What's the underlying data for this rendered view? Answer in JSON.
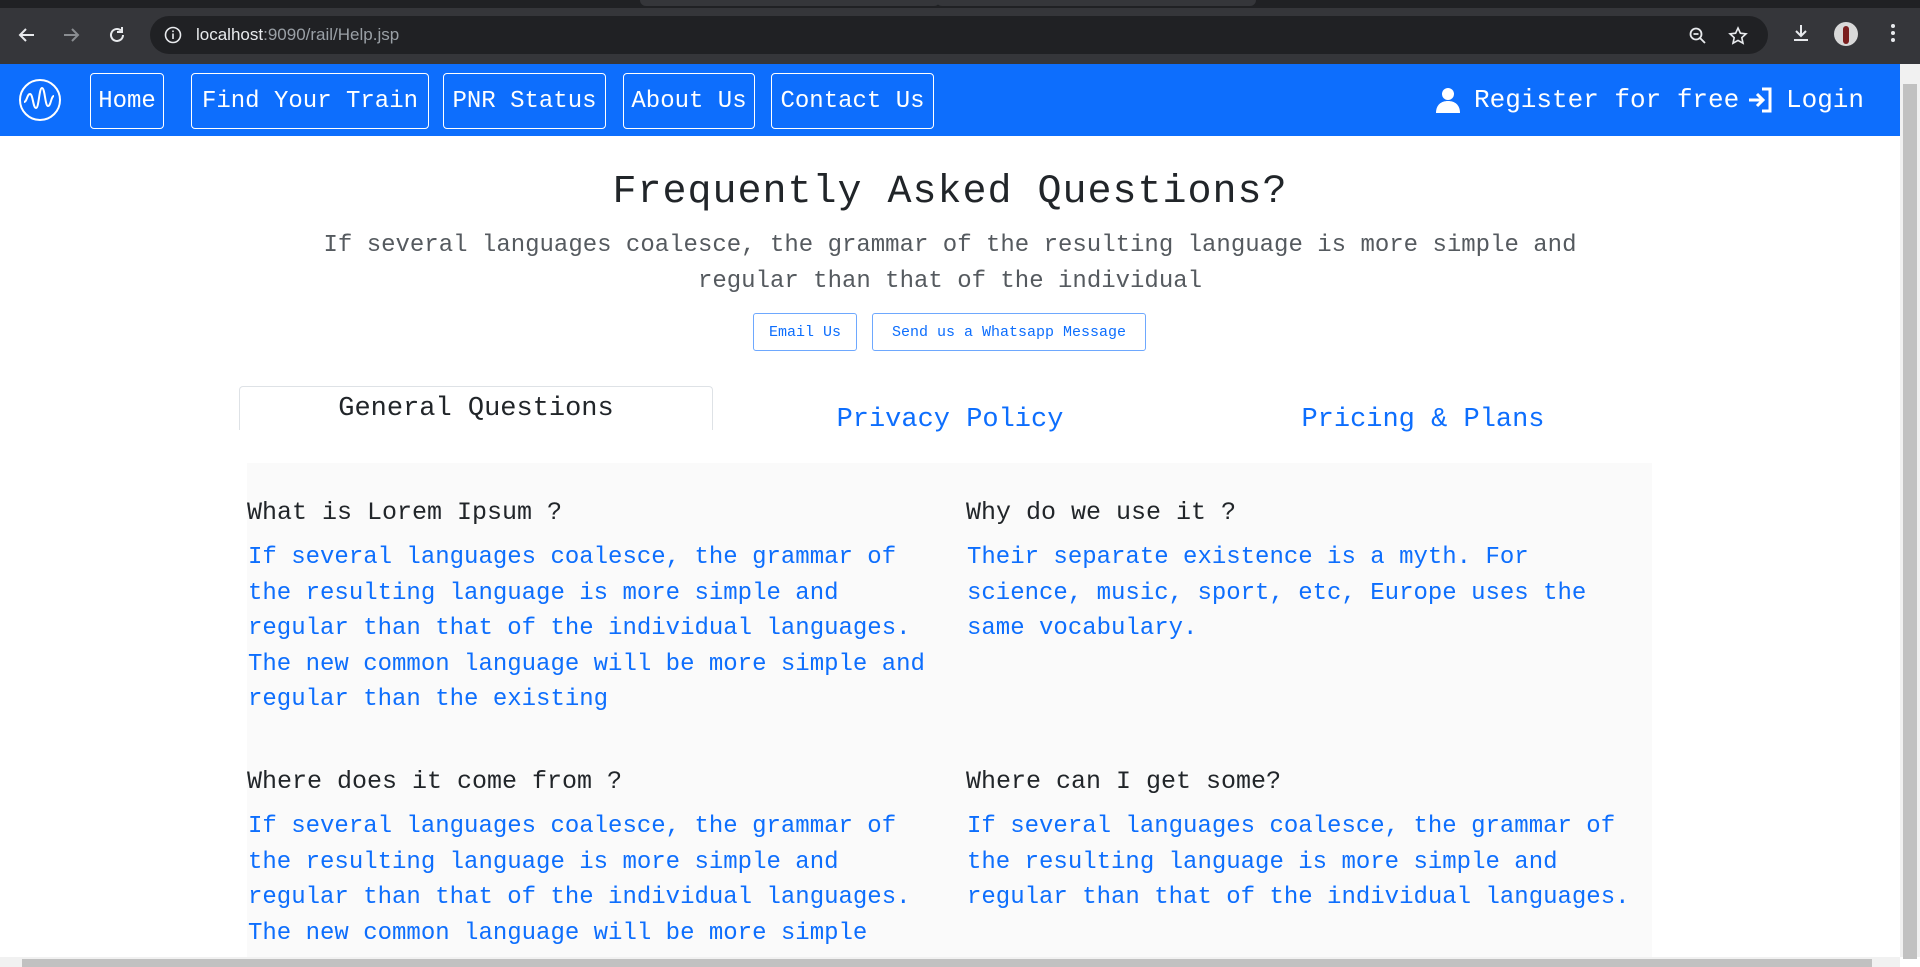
{
  "browser": {
    "url_host": "localhost",
    "url_path": ":9090/rail/Help.jsp"
  },
  "navbar": {
    "items": [
      {
        "label": "Home"
      },
      {
        "label": "Find Your Train"
      },
      {
        "label": "PNR Status"
      },
      {
        "label": "About Us"
      },
      {
        "label": "Contact Us"
      }
    ],
    "register_label": "Register for free",
    "login_label": "Login"
  },
  "header": {
    "title": "Frequently Asked Questions?",
    "subtitle": "If several languages coalesce, the grammar of the resulting language is more simple and regular than that of the individual",
    "email_button": "Email Us",
    "whatsapp_button": "Send us a Whatsapp Message"
  },
  "tabs": [
    {
      "label": "General Questions"
    },
    {
      "label": "Privacy Policy"
    },
    {
      "label": "Pricing & Plans"
    }
  ],
  "faqs": [
    {
      "question": "What is Lorem Ipsum ?",
      "answer": "If several languages coalesce, the grammar of the resulting language is more simple and regular than that of the individual languages. The new common language will be more simple and regular than the existing"
    },
    {
      "question": "Why do we use it ?",
      "answer": "Their separate existence is a myth. For science, music, sport, etc, Europe uses the same vocabulary."
    },
    {
      "question": "Where does it come from ?",
      "answer": "If several languages coalesce, the grammar of the resulting language is more simple and regular than that of the individual languages. The new common language will be more simple"
    },
    {
      "question": "Where can I get some?",
      "answer": "If several languages coalesce, the grammar of the resulting language is more simple and regular than that of the individual languages."
    }
  ],
  "colors": {
    "brand": "#0d6efd",
    "chrome": "#35363a"
  }
}
